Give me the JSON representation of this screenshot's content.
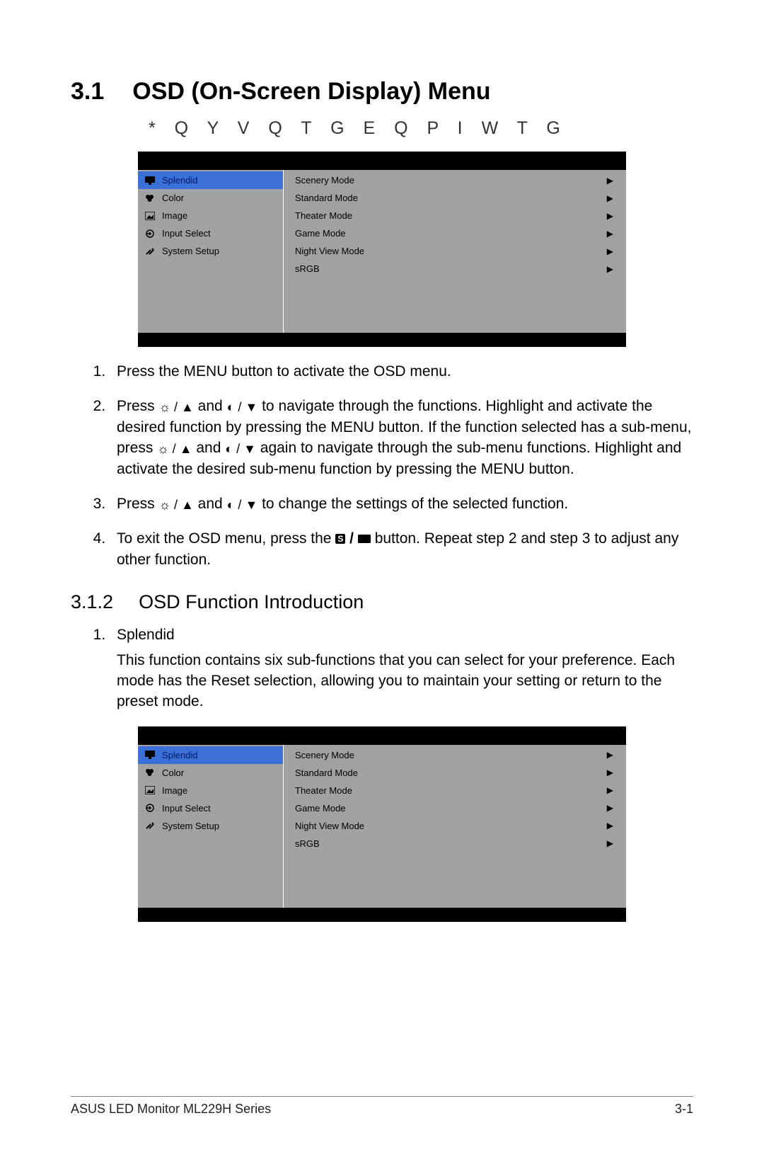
{
  "section": {
    "num": "3.1",
    "title": "OSD (On-Screen Display) Menu"
  },
  "subheading": "* Q Y   V Q   T G E Q P   I W T G",
  "osd": {
    "left": [
      {
        "label": "Splendid",
        "icon": "monitor-icon",
        "selected": true
      },
      {
        "label": "Color",
        "icon": "palette-icon",
        "selected": false
      },
      {
        "label": "Image",
        "icon": "image-icon",
        "selected": false
      },
      {
        "label": "Input Select",
        "icon": "input-icon",
        "selected": false
      },
      {
        "label": "System Setup",
        "icon": "tools-icon",
        "selected": false
      }
    ],
    "right": [
      {
        "label": "Scenery Mode"
      },
      {
        "label": "Standard Mode"
      },
      {
        "label": "Theater Mode"
      },
      {
        "label": "Game Mode"
      },
      {
        "label": "Night View Mode"
      },
      {
        "label": "sRGB"
      }
    ]
  },
  "steps": {
    "s1": "Press the MENU button to activate the OSD menu.",
    "s2a": "Press ",
    "s2b": " and  ",
    "s2c": " to navigate through the functions. Highlight and activate the desired function by pressing the MENU button. If the function selected has a sub-menu, press ",
    "s2d": " and  ",
    "s2e": " again to navigate through the sub-menu functions. Highlight and activate the desired sub-menu function by pressing the MENU button.",
    "s3a": "Press ",
    "s3b": " and  ",
    "s3c": " to change the settings of the selected function.",
    "s4a": "To exit the OSD menu, press the ",
    "s4b": " button. Repeat step 2 and step 3 to adjust any other function."
  },
  "subsection": {
    "num": "3.1.2",
    "title": "OSD Function Introduction"
  },
  "splendid": {
    "title": "Splendid",
    "desc": "This function contains six sub-functions that you can select for your preference. Each mode has the Reset selection, allowing you to maintain your setting or return to the preset mode."
  },
  "footer": {
    "left": "ASUS LED Monitor ML229H Series",
    "right": "3-1"
  }
}
